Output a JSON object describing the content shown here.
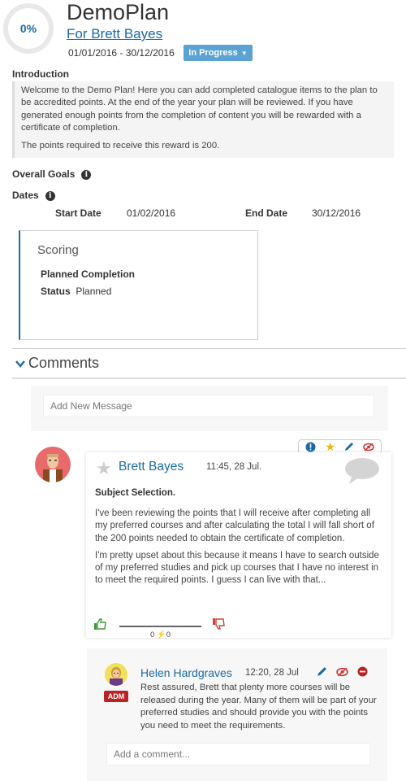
{
  "plan": {
    "progress": "0%",
    "title": "DemoPlan",
    "owner": "For Brett Bayes",
    "dates": "01/01/2016 - 30/12/2016",
    "status": "In Progress"
  },
  "introduction": {
    "label": "Introduction",
    "paragraph1": "Welcome to the Demo Plan! Here you can add completed catalogue items to the plan to be accredited points. At the end of the year your plan will be reviewed. If you have generated enough points from the completion of content you will be rewarded with a certificate of completion.",
    "paragraph2": "The points required to receive this reward is 200."
  },
  "overall_goals": {
    "label": "Overall Goals"
  },
  "dates": {
    "label": "Dates",
    "start_label": "Start Date",
    "start_value": "01/02/2016",
    "end_label": "End Date",
    "end_value": "30/12/2016"
  },
  "scoring": {
    "title": "Scoring",
    "planned_completion_label": "Planned Completion",
    "status_label": "Status",
    "status_value": "Planned"
  },
  "comments": {
    "header": "Comments",
    "new_message_placeholder": "Add New Message",
    "items": [
      {
        "author": "Brett Bayes",
        "time": "11:45, 28 Jul.",
        "subject": "Subject Selection.",
        "paragraph1": "I've been reviewing the points that I will receive after completing all my preferred courses and after calculating the total I will fall short of the 200 points needed to obtain the certificate of completion.",
        "paragraph2": "I'm pretty upset about this because it means I have to search outside of my preferred studies and pick up courses that I have no interest in to meet the required points. I guess I can live with that...",
        "vote_score": "0 ⚡0",
        "replies": [
          {
            "author": "Helen Hardgraves",
            "time": "12:20, 28 Jul",
            "badge": "ADM",
            "text": "Rest assured, Brett that plenty more courses will be released during the year. Many of them will be part of your preferred studies and should provide you with the points you need to meet the requirements."
          }
        ],
        "add_comment_placeholder": "Add a comment..."
      }
    ]
  },
  "colors": {
    "accent": "#1b6aa5",
    "status_button": "#5aa3d3",
    "admin_badge": "#bb2222"
  },
  "icons": [
    "info-icon",
    "chevron-down-icon",
    "flag-icon",
    "star-icon",
    "pencil-icon",
    "hide-icon",
    "comment-bubble-icon",
    "thumbs-up-icon",
    "thumbs-down-icon",
    "remove-icon"
  ]
}
